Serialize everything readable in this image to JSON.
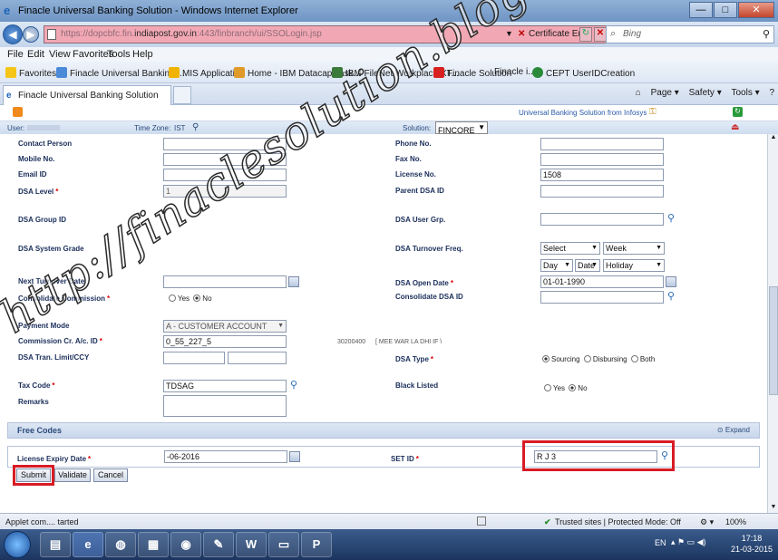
{
  "window": {
    "title": "Finacle Universal Banking Solution - Windows Internet Explorer",
    "minimize": "—",
    "maximize": "□",
    "close": "✕"
  },
  "address": {
    "url_prefix": "https://",
    "url_blur1": "dopcbfc.fin.",
    "url_host": "indiapost.gov.in",
    "url_blur2": ":443/finbranch/ui/SSOLogin.jsp",
    "cert_error": "Certificate Error",
    "search_placeholder": "Bing"
  },
  "menu": [
    "File",
    "Edit",
    "View",
    "Favorites",
    "Tools",
    "Help"
  ],
  "favorites": [
    {
      "label": "Favorites",
      "color": "#f5c518"
    },
    {
      "label": "Finacle Universal Banking ...",
      "color": "#4a8ad8"
    },
    {
      "label": "MIS Application",
      "color": "#f0b400"
    },
    {
      "label": "Home - IBM Datacap Task...",
      "color": "#e09a2a"
    },
    {
      "label": "IBM FileNet Workplace XT...",
      "color": "#3a7a3a"
    },
    {
      "label": "Finacle Solution",
      "color": "#d82020"
    },
    {
      "label": "Finacle i...",
      "color": "#6a6a6a"
    },
    {
      "label": "CEPT UserIDCreation",
      "color": "#2a8a3a"
    }
  ],
  "tab": {
    "label": "Finacle Universal Banking Solution"
  },
  "commands": [
    "Page ▾",
    "Safety ▾",
    "Tools ▾",
    "?"
  ],
  "app": {
    "brand": "Universal Banking Solution from Infosys",
    "user_label": "User:",
    "timezone_label": "Time Zone:",
    "timezone_value": "IST",
    "solution_label": "Solution:",
    "solution_value": "FINCORE"
  },
  "form": {
    "contact_person": {
      "label": "Contact Person",
      "value": ""
    },
    "phone_no": {
      "label": "Phone No.",
      "value": ""
    },
    "mobile_no": {
      "label": "Mobile No.",
      "value": ""
    },
    "fax_no": {
      "label": "Fax No.",
      "value": ""
    },
    "email_id": {
      "label": "Email ID",
      "value": ""
    },
    "license_no": {
      "label": "License No.",
      "value": "1508"
    },
    "dsa_level": {
      "label": "DSA Level",
      "value": "1"
    },
    "parent_dsa_id": {
      "label": "Parent DSA ID",
      "value": ""
    },
    "dsa_group_id": {
      "label": "DSA Group ID"
    },
    "dsa_user_grp": {
      "label": "DSA User Grp.",
      "value": ""
    },
    "dsa_system_grade": {
      "label": "DSA System Grade"
    },
    "dsa_turnover_freq": {
      "label": "DSA Turnover Freq.",
      "select1": "Select",
      "select2": "Week",
      "select3": "Day",
      "select4": "Date",
      "select5": "Holiday"
    },
    "next_turnover_date": {
      "label": "Next Turnover Date",
      "value": ""
    },
    "dsa_open_date": {
      "label": "DSA Open Date",
      "value": "01-01-1990"
    },
    "consolidate_commission": {
      "label": "Consolidate Commission",
      "yes": "Yes",
      "no": "No",
      "selected": "No"
    },
    "consolidate_dsa_id": {
      "label": "Consolidate DSA ID",
      "value": ""
    },
    "payment_mode": {
      "label": "Payment Mode",
      "value": "A - CUSTOMER ACCOUNT"
    },
    "commission_acid": {
      "label": "Commission Cr. A/c. ID",
      "value": "0_55_227_5",
      "desc_code": "30200400",
      "desc_text": "[ MEE WAR LA  DHI IF \\"
    },
    "dsa_tran_limit": {
      "label": "DSA Tran. Limit/CCY",
      "value": ""
    },
    "dsa_type": {
      "label": "DSA Type",
      "opt1": "Sourcing",
      "opt2": "Disbursing",
      "opt3": "Both",
      "selected": "Sourcing"
    },
    "tax_code": {
      "label": "Tax Code",
      "value": "TDSAG"
    },
    "black_listed": {
      "label": "Black Listed",
      "yes": "Yes",
      "no": "No",
      "selected": "No"
    },
    "remarks": {
      "label": "Remarks",
      "value": ""
    },
    "free_codes": {
      "label": "Free Codes",
      "expand": "Expand"
    },
    "license_expiry_date": {
      "label": "License Expiry Date",
      "value": "-06-2016"
    },
    "set_id": {
      "label": "SET ID",
      "value": "R J 3"
    }
  },
  "buttons": {
    "submit": "Submit",
    "validate": "Validate",
    "cancel": "Cancel"
  },
  "status": {
    "left": "Applet com.... tarted",
    "zone": "Trusted sites | Protected Mode: Off",
    "zoom": "100%"
  },
  "taskbar": {
    "lang": "EN",
    "time": "17:18",
    "date": "21-03-2015"
  },
  "watermark": "http://finaclesolution.blogspot.in/",
  "colors": {
    "highlight_red": "#d81c25",
    "url_error_bg": "#f2a8b4"
  }
}
